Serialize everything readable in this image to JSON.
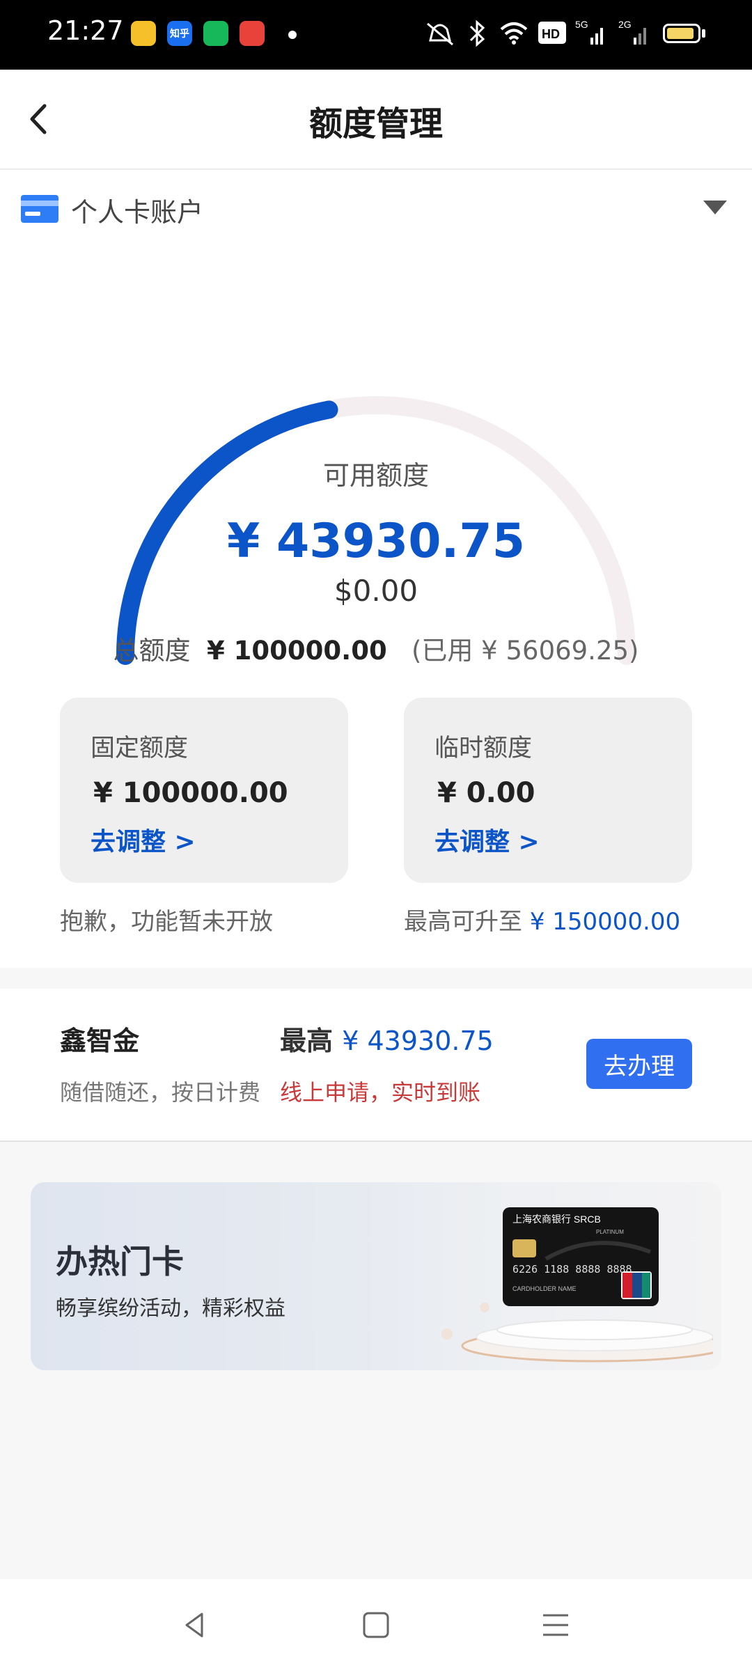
{
  "status_bar": {
    "time": "21:27",
    "apps": [
      {
        "name": "notes-app-icon",
        "color": "#f5c02a",
        "label": ""
      },
      {
        "name": "zhihu-app-icon",
        "color": "#1a6ff0",
        "label": "知乎"
      },
      {
        "name": "green-app-icon",
        "color": "#16b85a",
        "label": ""
      },
      {
        "name": "red-app-icon",
        "color": "#e8423b",
        "label": ""
      }
    ],
    "indicators": "5G 2G",
    "accent_battery": "#f4d566"
  },
  "header": {
    "title": "额度管理"
  },
  "account": {
    "label": "个人卡账户"
  },
  "gauge": {
    "label": "可用额度",
    "available": "¥ 43930.75",
    "usd": "$0.00",
    "fraction_available": 0.44,
    "color_fill": "#0c55c8",
    "color_track": "#f4eef1"
  },
  "total": {
    "label": "总额度",
    "amount": "¥ 100000.00",
    "used": "(已用 ¥ 56069.25)"
  },
  "fixed": {
    "title": "固定额度",
    "amount": "¥ 100000.00",
    "link": "去调整 >",
    "note": "抱歉，功能暂未开放"
  },
  "temporary": {
    "title": "临时额度",
    "amount": "¥ 0.00",
    "link": "去调整 >",
    "note_prefix": "最高可升至",
    "note_amount": "¥ 150000.00"
  },
  "loan": {
    "name": "鑫智金",
    "max_label": "最高",
    "max_amount": "¥ 43930.75",
    "desc": "随借随还，按日计费",
    "promo": "线上申请，实时到账",
    "button": "去办理"
  },
  "banner": {
    "title": "办热门卡",
    "subtitle": "畅享缤纷活动，精彩权益",
    "card_bank": "上海农商银行 SRCB",
    "card_number": "6226 1188 8888 8888",
    "card_holder": "CARDHOLDER NAME",
    "card_tier": "PLATINUM"
  }
}
